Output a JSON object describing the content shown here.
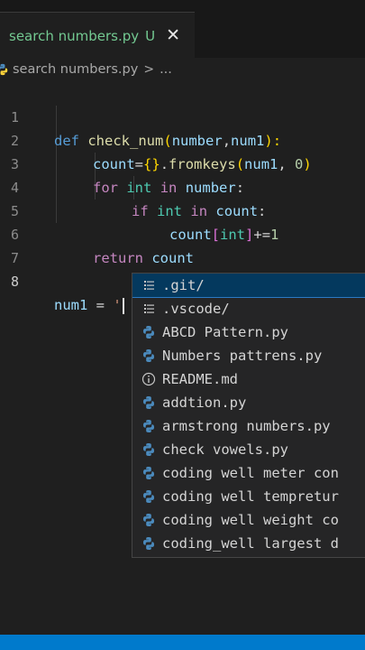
{
  "tab": {
    "filename": "search numbers.py",
    "badge": "U",
    "close": "✕"
  },
  "breadcrumb": {
    "file": "search numbers.py",
    "separator": ">",
    "ellipsis": "..."
  },
  "editor": {
    "line_numbers": [
      "1",
      "2",
      "3",
      "4",
      "5",
      "6",
      "7",
      "8"
    ],
    "lines": {
      "l1": {
        "kw": "def",
        "fn": "check_num",
        "paren_open": "(",
        "p1": "number",
        "comma": ",",
        "p2": "num1",
        "paren_close": "):"
      },
      "l2": {
        "var": "count",
        "eq": "=",
        "brace": "{}",
        "dot": ".",
        "fn": "fromkeys",
        "po": "(",
        "arg1": "num1",
        "comma": ", ",
        "arg2": "0",
        "pc": ")"
      },
      "l3": {
        "kw1": "for",
        "var1": "int",
        "kw2": "in",
        "var2": "number",
        "colon": ":"
      },
      "l4": {
        "kw1": "if",
        "var1": "int",
        "kw2": "in",
        "var2": "count",
        "colon": ":"
      },
      "l5": {
        "var1": "count",
        "bo": "[",
        "var2": "int",
        "bc": "]",
        "op": "+=",
        "num": "1"
      },
      "l6": {
        "kw": "return",
        "var": "count"
      },
      "l8": {
        "var": "num1",
        "eq": " = ",
        "str": "'"
      }
    }
  },
  "suggestions": [
    {
      "label": ".git/",
      "icon": "folder-icon"
    },
    {
      "label": ".vscode/",
      "icon": "folder-icon"
    },
    {
      "label": "ABCD Pattern.py",
      "icon": "python-icon"
    },
    {
      "label": "Numbers pattrens.py",
      "icon": "python-icon"
    },
    {
      "label": "README.md",
      "icon": "info-icon"
    },
    {
      "label": "addtion.py",
      "icon": "python-icon"
    },
    {
      "label": "armstrong numbers.py",
      "icon": "python-icon"
    },
    {
      "label": "check vowels.py",
      "icon": "python-icon"
    },
    {
      "label": "coding well meter con",
      "icon": "python-icon"
    },
    {
      "label": "coding well tempretur",
      "icon": "python-icon"
    },
    {
      "label": "coding well weight co",
      "icon": "python-icon"
    },
    {
      "label": "coding_well largest d",
      "icon": "python-icon"
    }
  ],
  "colors": {
    "accent": "#007acc",
    "untracked": "#73c991",
    "selection": "#04395e"
  }
}
